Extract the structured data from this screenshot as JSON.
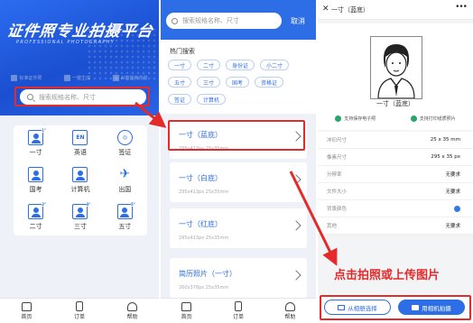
{
  "screen1": {
    "hero_title": "证件照专业拍摄平台",
    "hero_subtitle": "PROFESSIONAL PHOTOGRAPHY",
    "features": [
      "标准证件照",
      "一键生成",
      "AI智能换背景"
    ],
    "search_placeholder": "搜索规格名称、尺寸",
    "categories": [
      {
        "label": "一寸",
        "icon": "person-1inch-icon",
        "tag": "1\""
      },
      {
        "label": "英语",
        "icon": "english-en-icon",
        "tag": "EN"
      },
      {
        "label": "签证",
        "icon": "globe-visa-icon",
        "tag": ""
      },
      {
        "label": "国考",
        "icon": "exam-document-icon",
        "tag": ""
      },
      {
        "label": "计算机",
        "icon": "computer-icon",
        "tag": ""
      },
      {
        "label": "出国",
        "icon": "airplane-icon",
        "tag": ""
      },
      {
        "label": "二寸",
        "icon": "person-2inch-icon",
        "tag": "2\""
      },
      {
        "label": "三寸",
        "icon": "person-3inch-icon",
        "tag": "3\""
      },
      {
        "label": "五寸",
        "icon": "person-5inch-icon",
        "tag": "5\""
      }
    ],
    "tabs": [
      "首页",
      "订单",
      "帮助"
    ]
  },
  "screen2": {
    "search_placeholder": "搜索规格名称、尺寸",
    "cancel": "取消",
    "hot_title": "热门搜索",
    "hot_chips": [
      "一寸",
      "二寸",
      "身份证",
      "小二寸",
      "五寸",
      "三寸",
      "国考",
      "资格证",
      "签证",
      "计算机"
    ],
    "specs": [
      {
        "name": "一寸（蓝底）",
        "dims": "295x413px   25x35mm"
      },
      {
        "name": "一寸（白底）",
        "dims": "295x413px   25x35mm"
      },
      {
        "name": "一寸（红底）",
        "dims": "295x413px   25x35mm"
      },
      {
        "name": "简历照片（一寸）",
        "dims": "260x378px   25x35mm"
      }
    ],
    "tabs": [
      "首页",
      "订单",
      "帮助"
    ]
  },
  "screen3": {
    "nav_title": "一寸（蓝底）",
    "photo_label": "一寸（蓝底）",
    "support": [
      "支持保存电子照",
      "支持打印纸质照片"
    ],
    "rows": [
      {
        "k": "冲印尺寸",
        "v": "25 x 35 mm"
      },
      {
        "k": "像素尺寸",
        "v": "295 x 35 px"
      },
      {
        "k": "分辨率",
        "v": "无要求"
      },
      {
        "k": "文件大小",
        "v": "无要求"
      },
      {
        "k": "背景颜色",
        "v": ""
      },
      {
        "k": "其他",
        "v": "无要求"
      }
    ],
    "bg_color": "#3579e8",
    "btn_album": "从相册选择",
    "btn_camera": "用相机拍摄"
  },
  "hint": "点击拍照或上传图片",
  "colors": {
    "primary": "#2d6ee6",
    "annotation": "#e52a2a"
  }
}
